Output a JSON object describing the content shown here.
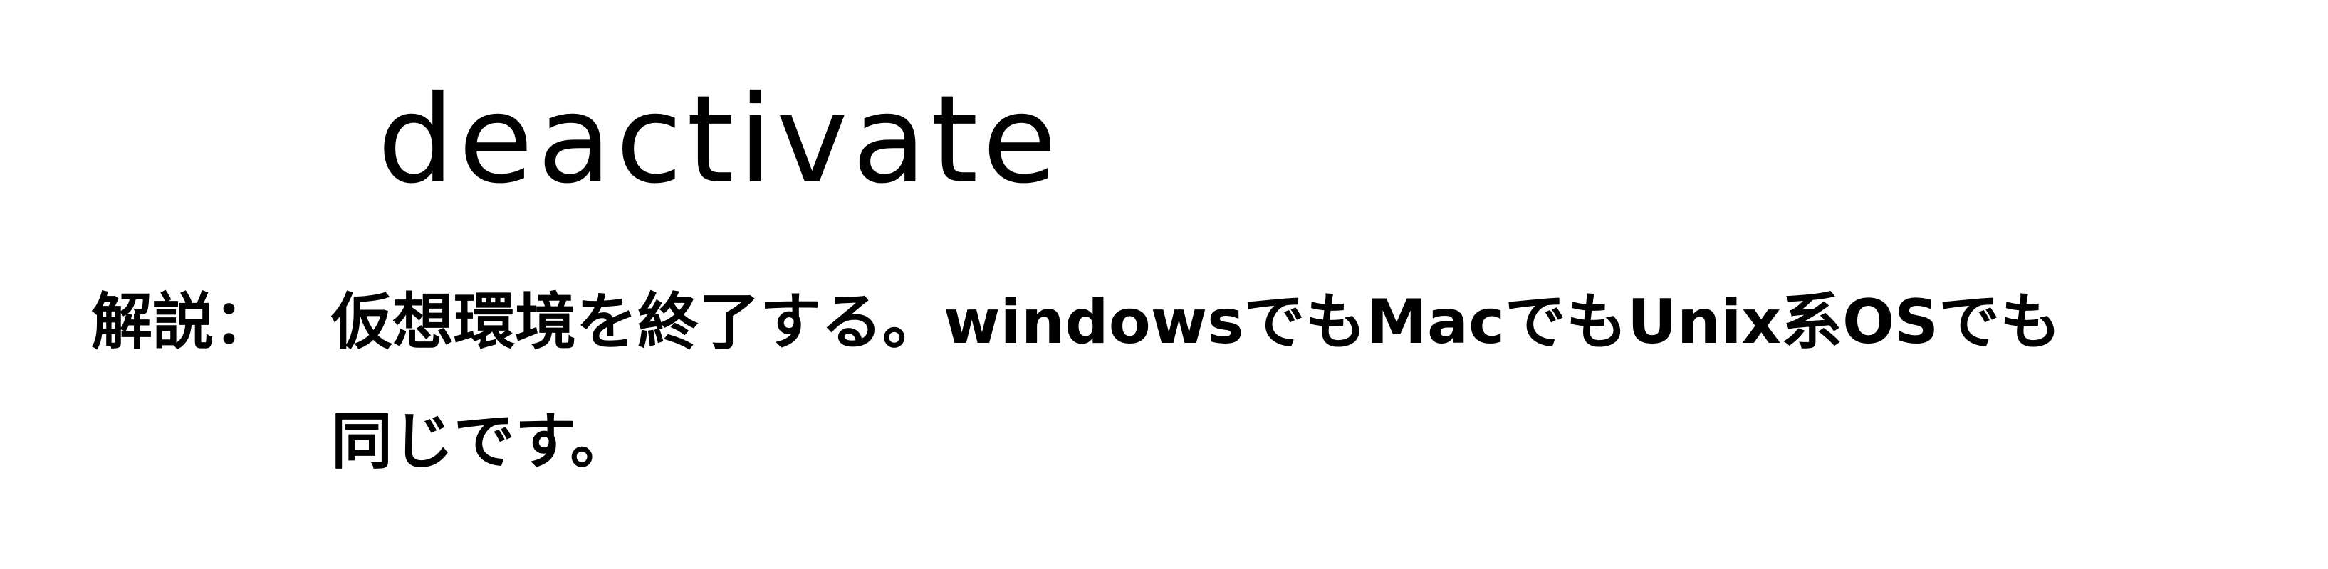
{
  "command": {
    "name": "deactivate"
  },
  "explanation": {
    "label": "解説：",
    "lines": [
      "仮想環境を終了する。windowsでもMacでもUnix系OSでも",
      "同じです。"
    ]
  }
}
